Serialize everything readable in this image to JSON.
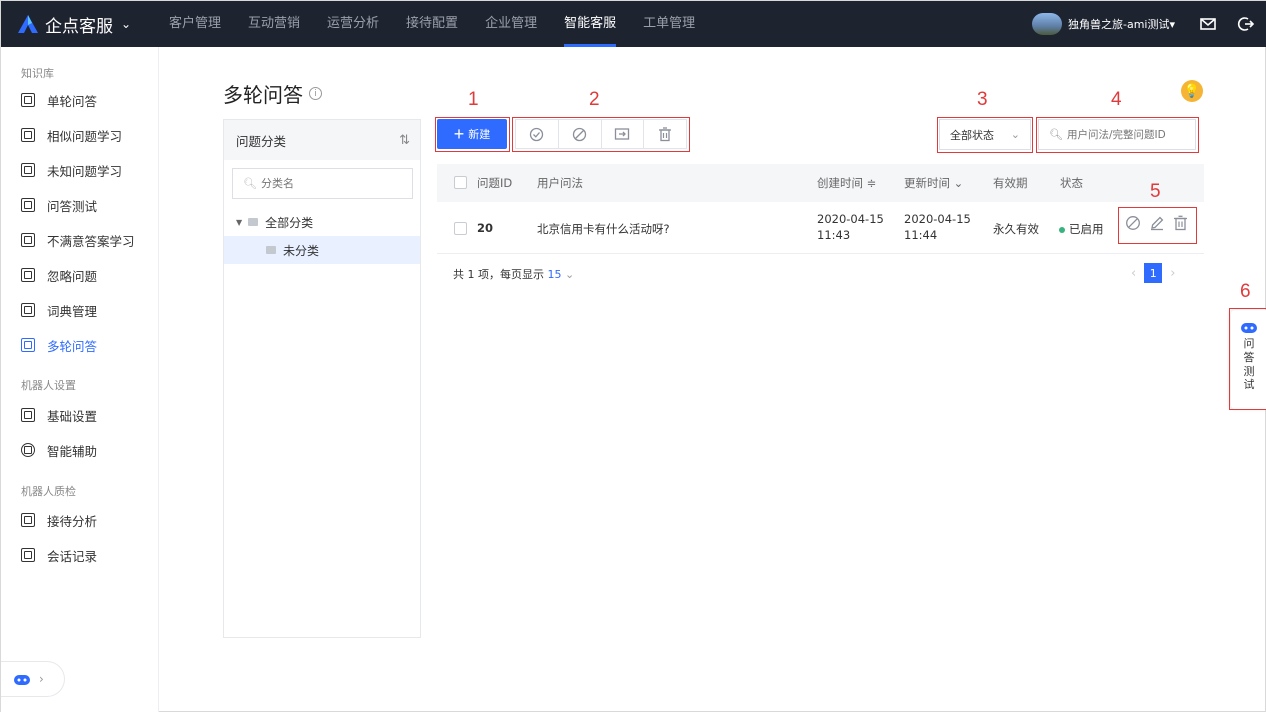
{
  "topnav": {
    "brand": "企点客服",
    "items": [
      "客户管理",
      "互动营销",
      "运营分析",
      "接待配置",
      "企业管理",
      "智能客服",
      "工单管理"
    ],
    "active_index": 5,
    "user_name": "独角兽之旅-ami测试▾"
  },
  "sidebar": {
    "sections": [
      {
        "title": "知识库",
        "items": [
          "单轮问答",
          "相似问题学习",
          "未知问题学习",
          "问答测试",
          "不满意答案学习",
          "忽略问题",
          "词典管理",
          "多轮问答"
        ]
      },
      {
        "title": "机器人设置",
        "items": [
          "基础设置",
          "智能辅助"
        ]
      },
      {
        "title": "机器人质检",
        "items": [
          "接待分析",
          "会话记录"
        ]
      }
    ],
    "active_item": "多轮问答"
  },
  "page": {
    "title": "多轮问答"
  },
  "category": {
    "header": "问题分类",
    "search_placeholder": "分类名",
    "tree": [
      "全部分类",
      "未分类"
    ]
  },
  "toolbar": {
    "new_label": "新建",
    "status_value": "全部状态",
    "search_placeholder": "用户问法/完整问题ID"
  },
  "table": {
    "columns": [
      "问题ID",
      "用户问法",
      "创建时间 ≑",
      "更新时间 ⌄",
      "有效期",
      "状态"
    ],
    "rows": [
      {
        "id": "20",
        "question": "北京信用卡有什么活动呀?",
        "created_date": "2020-04-15",
        "created_time": "11:43",
        "updated_date": "2020-04-15",
        "updated_time": "11:44",
        "validity": "永久有效",
        "status": "已启用"
      }
    ]
  },
  "pagination": {
    "summary": "共 1 项，每页显示",
    "page_size": "15",
    "current_page": "1"
  },
  "float_widget": {
    "chars": [
      "问",
      "答",
      "测",
      "试"
    ]
  },
  "annotations": [
    "1",
    "2",
    "3",
    "4",
    "5",
    "6"
  ],
  "colors": {
    "accent": "#2f6bff",
    "nav_bg": "#1e2330",
    "annotation": "#e03a3a",
    "status_ok": "#36b37e"
  }
}
